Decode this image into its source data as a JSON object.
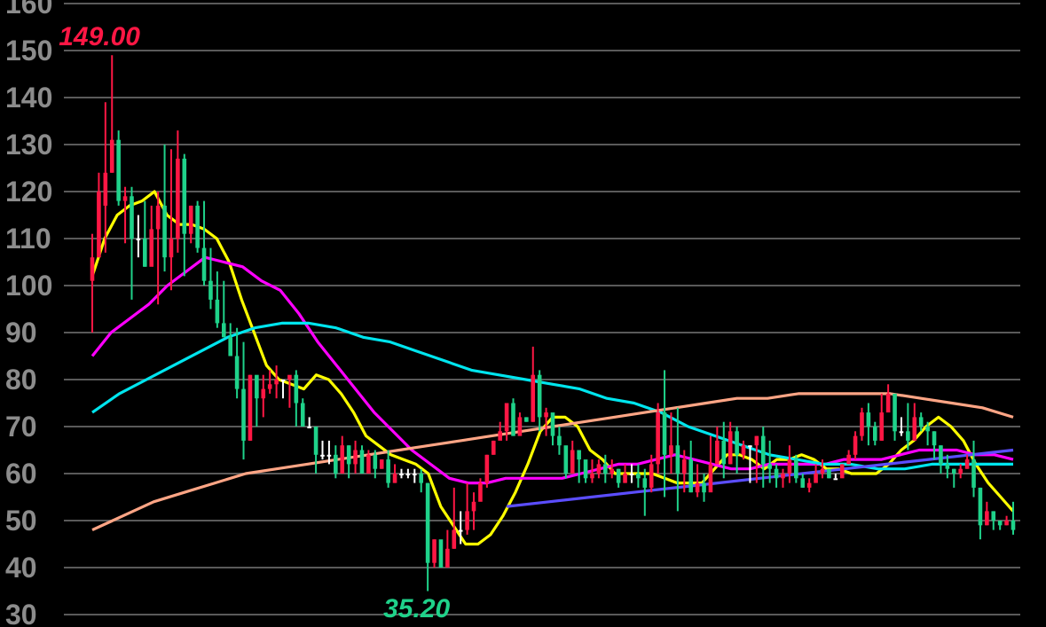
{
  "chart_data": {
    "type": "candlestick",
    "ylim": [
      30,
      160
    ],
    "y_ticks": [
      30,
      40,
      50,
      60,
      70,
      80,
      90,
      100,
      110,
      120,
      130,
      140,
      150
    ],
    "grid": true,
    "colors": {
      "up": "#ff1744",
      "down": "#1fd28a",
      "neutral": "#ffffff",
      "grid": "#5a5a5a",
      "tick": "#8c8c8c"
    },
    "annotations": {
      "high": {
        "label": "149.00",
        "value": 149.0,
        "index": 3
      },
      "low": {
        "label": "35.20",
        "value": 35.2,
        "index": 51
      }
    },
    "candles": [
      [
        101,
        106,
        90,
        111
      ],
      [
        106,
        120,
        106,
        124
      ],
      [
        117,
        124,
        107,
        139
      ],
      [
        124,
        131,
        124,
        149
      ],
      [
        131,
        118,
        117,
        133
      ],
      [
        118,
        119,
        109,
        121
      ],
      [
        119,
        110,
        97,
        121
      ],
      [
        110,
        110,
        106,
        115
      ],
      [
        110,
        104,
        104,
        118
      ],
      [
        104,
        112,
        108,
        117
      ],
      [
        112,
        117,
        96,
        120
      ],
      [
        117,
        106,
        103,
        130
      ],
      [
        106,
        110,
        99,
        129
      ],
      [
        110,
        127,
        107,
        133
      ],
      [
        127,
        111,
        102,
        128
      ],
      [
        111,
        117,
        109,
        117
      ],
      [
        117,
        108,
        107,
        118
      ],
      [
        108,
        101,
        100,
        118
      ],
      [
        101,
        97,
        95,
        108
      ],
      [
        97,
        92,
        91,
        103
      ],
      [
        92,
        89,
        89,
        101
      ],
      [
        89,
        85,
        85,
        92
      ],
      [
        85,
        78,
        76,
        91
      ],
      [
        78,
        67,
        63,
        88
      ],
      [
        67,
        81,
        67,
        81
      ],
      [
        81,
        76,
        70,
        77
      ],
      [
        76,
        78,
        72,
        81
      ],
      [
        78,
        79,
        77,
        82
      ],
      [
        79,
        80,
        76,
        83
      ],
      [
        80,
        80,
        76,
        80
      ],
      [
        80,
        81,
        74,
        80
      ],
      [
        81,
        75,
        70,
        82
      ],
      [
        75,
        70,
        70,
        76
      ],
      [
        70,
        70,
        70,
        72
      ],
      [
        70,
        64,
        60,
        70
      ],
      [
        64,
        64,
        63,
        67
      ],
      [
        64,
        64,
        62,
        67
      ],
      [
        64,
        60,
        59,
        66
      ],
      [
        60,
        66,
        61,
        68
      ],
      [
        66,
        62,
        59,
        66
      ],
      [
        62,
        65,
        60,
        67
      ],
      [
        65,
        60,
        63,
        66
      ],
      [
        60,
        64,
        63,
        65
      ],
      [
        64,
        61,
        59,
        65
      ],
      [
        61,
        63,
        61,
        63
      ],
      [
        63,
        58,
        57,
        65
      ],
      [
        58,
        60,
        58,
        62
      ],
      [
        60,
        60,
        59,
        61
      ],
      [
        60,
        60,
        59,
        61
      ],
      [
        60,
        60,
        58,
        61
      ],
      [
        60,
        58,
        56,
        61
      ],
      [
        58,
        41,
        35,
        58
      ],
      [
        41,
        46,
        40,
        46
      ],
      [
        46,
        40,
        40,
        45
      ],
      [
        40,
        44,
        42,
        48
      ],
      [
        44,
        48,
        44,
        57
      ],
      [
        48,
        48,
        45,
        52
      ],
      [
        48,
        52,
        47,
        58
      ],
      [
        52,
        54,
        48,
        56
      ],
      [
        54,
        58,
        55,
        59
      ],
      [
        58,
        64,
        57,
        64
      ],
      [
        64,
        67,
        64,
        67
      ],
      [
        67,
        69,
        68,
        71
      ],
      [
        69,
        75,
        67,
        75
      ],
      [
        75,
        68,
        68,
        76
      ],
      [
        68,
        72,
        71,
        73
      ],
      [
        72,
        71,
        71,
        72
      ],
      [
        71,
        81,
        71,
        87
      ],
      [
        81,
        72,
        69,
        82
      ],
      [
        72,
        73,
        68,
        74
      ],
      [
        73,
        68,
        66,
        70
      ],
      [
        68,
        66,
        64,
        70
      ],
      [
        66,
        60,
        59,
        64
      ],
      [
        60,
        65,
        60,
        67
      ],
      [
        65,
        63,
        58,
        65
      ],
      [
        63,
        59,
        58,
        61
      ],
      [
        59,
        60,
        58,
        63
      ],
      [
        60,
        62,
        59,
        63
      ],
      [
        62,
        60,
        58,
        64
      ],
      [
        60,
        61,
        59,
        63
      ],
      [
        61,
        58,
        57,
        61
      ],
      [
        58,
        60,
        58,
        62
      ],
      [
        60,
        60,
        58,
        62
      ],
      [
        60,
        59,
        57,
        62
      ],
      [
        59,
        57,
        51,
        61
      ],
      [
        57,
        62,
        56,
        64
      ],
      [
        62,
        73,
        60,
        75
      ],
      [
        73,
        64,
        55,
        82
      ],
      [
        64,
        66,
        60,
        73
      ],
      [
        66,
        60,
        52,
        74
      ],
      [
        60,
        63,
        56,
        65
      ],
      [
        63,
        56,
        56,
        67
      ],
      [
        56,
        58,
        55,
        62
      ],
      [
        58,
        56,
        54,
        60
      ],
      [
        56,
        62,
        57,
        68
      ],
      [
        62,
        67,
        63,
        70
      ],
      [
        67,
        62,
        59,
        71
      ],
      [
        62,
        69,
        62,
        71
      ],
      [
        69,
        64,
        60,
        70
      ],
      [
        64,
        66,
        63,
        67
      ],
      [
        66,
        66,
        58,
        66
      ],
      [
        66,
        68,
        58,
        68
      ],
      [
        68,
        62,
        57,
        70
      ],
      [
        62,
        61,
        58,
        67
      ],
      [
        61,
        59,
        57,
        62
      ],
      [
        59,
        60,
        57,
        61
      ],
      [
        60,
        63,
        58,
        66
      ],
      [
        63,
        59,
        58,
        64
      ],
      [
        59,
        57,
        57,
        60
      ],
      [
        57,
        58,
        56,
        59
      ],
      [
        58,
        60,
        59,
        62
      ],
      [
        60,
        61,
        59,
        63
      ],
      [
        61,
        59,
        59,
        60
      ],
      [
        59,
        59,
        59,
        60
      ],
      [
        59,
        62,
        61,
        62
      ],
      [
        62,
        64,
        62,
        65
      ],
      [
        64,
        68,
        63,
        69
      ],
      [
        68,
        73,
        67,
        74
      ],
      [
        73,
        70,
        66,
        75
      ],
      [
        70,
        67,
        66,
        71
      ],
      [
        67,
        73,
        67,
        77
      ],
      [
        73,
        77,
        74,
        79
      ],
      [
        77,
        69,
        67,
        77
      ],
      [
        69,
        69,
        68,
        72
      ],
      [
        69,
        67,
        65,
        75
      ],
      [
        67,
        72,
        68,
        75
      ],
      [
        72,
        70,
        69,
        73
      ],
      [
        70,
        69,
        66,
        71
      ],
      [
        69,
        66,
        63,
        69
      ],
      [
        66,
        62,
        60,
        66
      ],
      [
        62,
        61,
        59,
        64
      ],
      [
        61,
        60,
        57,
        61
      ],
      [
        60,
        61,
        59,
        62
      ],
      [
        61,
        63,
        61,
        64
      ],
      [
        63,
        57,
        55,
        67
      ],
      [
        57,
        49,
        46,
        57
      ],
      [
        49,
        52,
        49,
        54
      ],
      [
        52,
        50,
        48,
        52
      ],
      [
        50,
        49,
        48,
        50
      ],
      [
        49,
        50,
        49,
        51
      ],
      [
        50,
        48,
        47,
        54
      ]
    ],
    "series": [
      {
        "type": "line",
        "color": "#ffff00",
        "values": [
          102,
          110,
          115,
          117,
          118,
          120,
          115,
          113,
          113,
          112,
          110,
          105,
          97,
          90,
          83,
          80,
          79,
          78,
          81,
          80,
          77,
          73,
          68,
          66,
          64,
          63,
          62,
          60,
          53,
          49,
          45,
          45,
          47,
          51,
          56,
          62,
          69,
          72,
          72,
          70,
          65,
          63,
          60,
          60,
          60,
          60,
          59,
          58,
          58,
          58,
          61,
          64,
          64,
          63,
          61,
          63,
          63,
          64,
          63,
          61,
          61,
          60,
          60,
          60,
          62,
          65,
          67,
          70,
          72,
          70,
          67,
          62,
          58,
          55,
          52
        ]
      },
      {
        "type": "line",
        "color": "#ff00ff",
        "values": [
          85,
          90,
          93,
          96,
          100,
          103,
          106,
          105,
          104,
          101,
          99,
          94,
          88,
          83,
          78,
          73,
          69,
          65,
          62,
          59,
          58,
          58,
          59,
          59,
          59,
          59,
          60,
          61,
          62,
          62,
          63,
          64,
          63,
          62,
          61,
          61,
          62,
          62,
          62,
          62,
          63,
          63,
          63,
          64,
          65,
          65,
          65,
          64,
          64,
          63
        ]
      },
      {
        "type": "line",
        "color": "#00e5ee",
        "values": [
          73,
          77,
          80,
          83,
          86,
          89,
          91,
          92,
          92,
          91,
          89,
          88,
          86,
          84,
          82,
          81,
          80,
          79,
          78,
          76,
          75,
          73,
          70,
          68,
          66,
          64,
          63,
          62,
          62,
          61,
          61,
          62,
          62,
          62,
          62
        ]
      },
      {
        "type": "line",
        "color": "#ffa585",
        "values": [
          48,
          51,
          54,
          56,
          58,
          60,
          61,
          62,
          63,
          64,
          65,
          66,
          67,
          68,
          69,
          70,
          71,
          72,
          73,
          74,
          75,
          76,
          76,
          77,
          77,
          77,
          77,
          76,
          75,
          74,
          72
        ]
      },
      {
        "type": "line",
        "color": "#5b4dff",
        "values": [
          53,
          54,
          55,
          56,
          57,
          58,
          59,
          60,
          61,
          62,
          63,
          64,
          65
        ]
      }
    ]
  }
}
